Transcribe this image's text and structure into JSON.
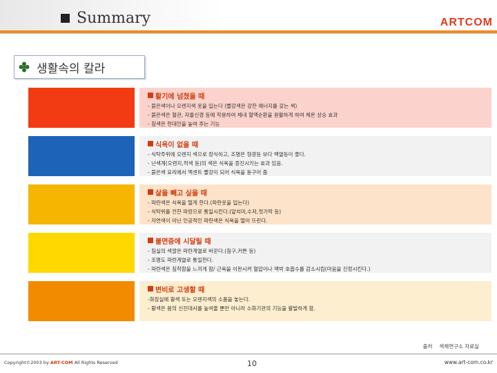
{
  "header": {
    "title": "Summary",
    "brand": "ARTCOM"
  },
  "section": {
    "title": "생활속의 칼라",
    "icon": "diamond-bullet-icon"
  },
  "swatches": [
    "#f23b12",
    "#1d63b8",
    "#f6b500",
    "#ffd800",
    "#f28b00",
    "#ffffff"
  ],
  "panels": [
    {
      "title": "활기에 넘쳤을 때",
      "background": "#fbd3cc",
      "lines": [
        "- 붉은색이나 오렌지색 옷을 입는다 (빨강색은 강한 에너지를 갖는 색)",
        "- 붉은색은 혈관, 자율신경 등에 작용하여 체내 혈액순환을 원활하게 하여 체온 상승 효과",
        "- 침색은 현대인을 높여 주는 기능"
      ]
    },
    {
      "title": "식욕이 없을 때",
      "background": "#f2f2f2",
      "lines": [
        "- 식탁주위에 오렌지 색으로 장식하고, 조명은 형광등 보다 백열등이 좋다.",
        "- 난색계(오렌지,적색 등)의 색은 식욕을 증진시키는 효과 있음.",
        "- 붉은색 요리에서 엑센트 빨강이 되어 식욕을 돋구어 줌"
      ]
    },
    {
      "title": "살을 빼고 싶을 때",
      "background": "#fde3c9",
      "lines": [
        "- 파란색은 식욕을 떨게 한다.(파란옷을 입는다)",
        "- 식탁위를 전한 파랑으로 통일시킨다.(앞치마,수저,젓가락 등)",
        "- 자연색이 아닌 인공적인 파란색은 식욕을 떨어 뜨린다."
      ]
    },
    {
      "title": "불면증에 시달릴 때",
      "background": "#f2f2f2",
      "lines": [
        "- 침실의 색깔은 파란계열로 바꾼다.(침구,커튼 등)",
        "- 조명도 파란계열로 통일한다.",
        "- 파란색은 침착함을 느끼게 함/ 근육을 이완시켜 혈압이나 맥박 호흡수를 감소시킴(마음을 진정시킨다.)"
      ]
    },
    {
      "title": "변비로 고생할 때",
      "background": "#fdeecf",
      "lines": [
        "-화장실에 황색 또는 오렌지색의 소품을 놓는다.",
        "- 황색은 몸의 신진대사를 높여줄 뿐만 아니라 소화기관의 기능을 활발하게 함."
      ]
    }
  ],
  "source": {
    "label": "출처",
    "name": "색채연구소 자료실"
  },
  "footer": {
    "copyright_prefix": "Copyright©2003 by",
    "copyright_brand": "ART-COM",
    "copyright_suffix": "All Rights Reserved",
    "page": "10",
    "url": "www.art-com.co.kr"
  },
  "colors": {
    "accent_orange": "#f08a1e",
    "brand_red": "#e23a1e",
    "title_red": "#d23c10"
  }
}
